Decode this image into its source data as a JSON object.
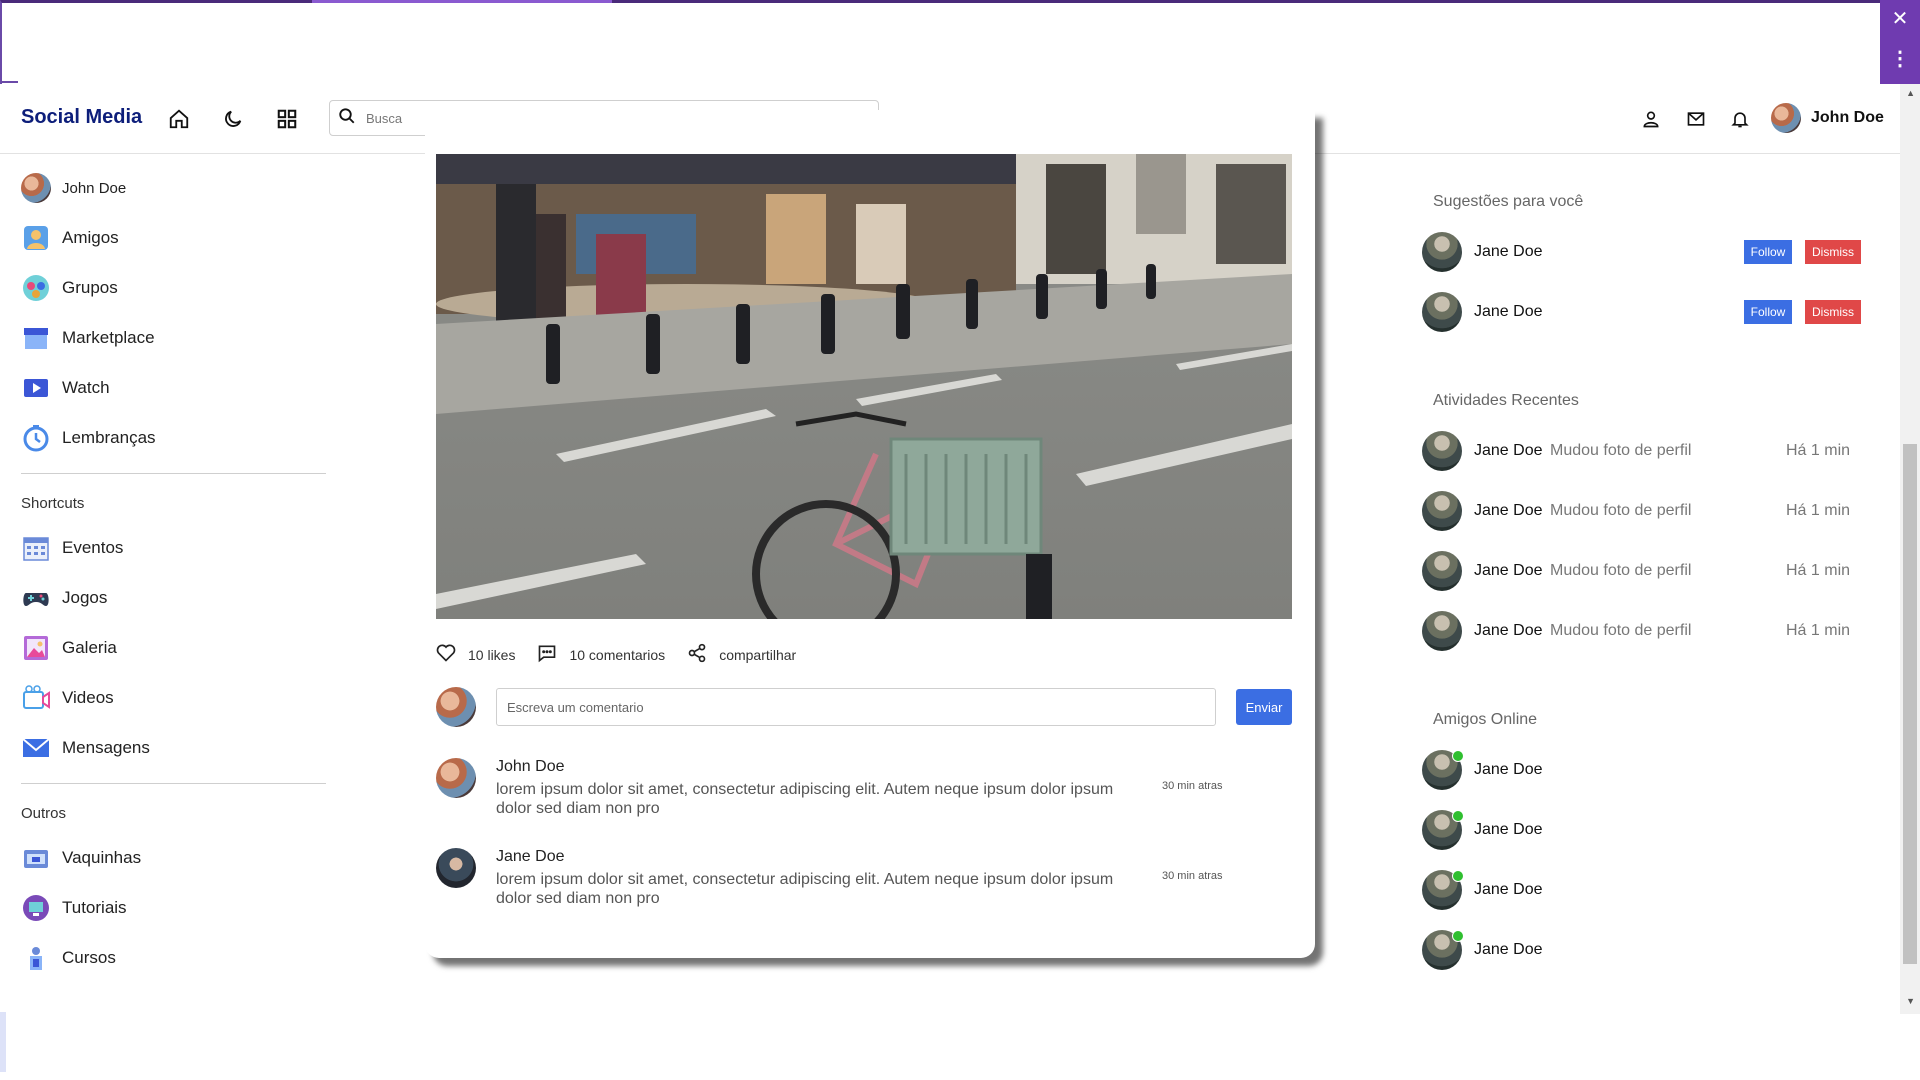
{
  "colors": {
    "brand": "#0d1e7a",
    "accent": "#3b6ee3",
    "danger": "#e04848",
    "online": "#2fbf2f",
    "extension": "#6f3bb0"
  },
  "extension": {
    "close_icon": "close-icon",
    "more_icon": "more-vertical-icon"
  },
  "navbar": {
    "brand": "Social Media",
    "search_placeholder": "Busca",
    "user_name": "John Doe",
    "icons": [
      "home-icon",
      "moon-icon",
      "grid-icon",
      "user-icon",
      "mail-icon",
      "bell-icon"
    ]
  },
  "sidebar": {
    "profile": "John Doe",
    "items": [
      {
        "label": "Amigos",
        "icon": "friends-icon"
      },
      {
        "label": "Grupos",
        "icon": "groups-icon"
      },
      {
        "label": "Marketplace",
        "icon": "marketplace-icon"
      },
      {
        "label": "Watch",
        "icon": "watch-icon"
      },
      {
        "label": "Lembranças",
        "icon": "memories-icon"
      }
    ],
    "shortcuts_heading": "Shortcuts",
    "shortcuts": [
      {
        "label": "Eventos",
        "icon": "calendar-icon"
      },
      {
        "label": "Jogos",
        "icon": "gamepad-icon"
      },
      {
        "label": "Galeria",
        "icon": "gallery-icon"
      },
      {
        "label": "Videos",
        "icon": "video-icon"
      },
      {
        "label": "Mensagens",
        "icon": "envelope-icon"
      }
    ],
    "others_heading": "Outros",
    "others": [
      {
        "label": "Vaquinhas",
        "icon": "fundraiser-icon"
      },
      {
        "label": "Tutoriais",
        "icon": "tutorial-icon"
      },
      {
        "label": "Cursos",
        "icon": "courses-icon"
      }
    ]
  },
  "post": {
    "likes": "10 likes",
    "comments": "10 comentarios",
    "share": "compartilhar",
    "comment_placeholder": "Escreva um comentario",
    "send_label": "Enviar",
    "comment_list": [
      {
        "name": "John Doe",
        "text": "lorem ipsum dolor sit amet, consectetur adipiscing elit. Autem neque ipsum dolor ipsum dolor sed diam non pro",
        "time": "30 min atras"
      },
      {
        "name": "Jane Doe",
        "text": "lorem ipsum dolor sit amet, consectetur adipiscing elit. Autem neque ipsum dolor ipsum dolor sed diam non pro",
        "time": "30 min atras"
      }
    ]
  },
  "right": {
    "suggestions_heading": "Sugestões para você",
    "suggestions": [
      {
        "name": "Jane Doe",
        "follow": "Follow",
        "dismiss": "Dismiss"
      },
      {
        "name": "Jane Doe",
        "follow": "Follow",
        "dismiss": "Dismiss"
      }
    ],
    "activities_heading": "Atividades Recentes",
    "activities": [
      {
        "name": "Jane Doe",
        "text": "Mudou foto de perfil",
        "time": "Há 1 min"
      },
      {
        "name": "Jane Doe",
        "text": "Mudou foto de perfil",
        "time": "Há 1 min"
      },
      {
        "name": "Jane Doe",
        "text": "Mudou foto de perfil",
        "time": "Há 1 min"
      },
      {
        "name": "Jane Doe",
        "text": "Mudou foto de perfil",
        "time": "Há 1 min"
      }
    ],
    "online_heading": "Amigos Online",
    "online": [
      {
        "name": "Jane Doe"
      },
      {
        "name": "Jane Doe"
      },
      {
        "name": "Jane Doe"
      },
      {
        "name": "Jane Doe"
      }
    ]
  }
}
